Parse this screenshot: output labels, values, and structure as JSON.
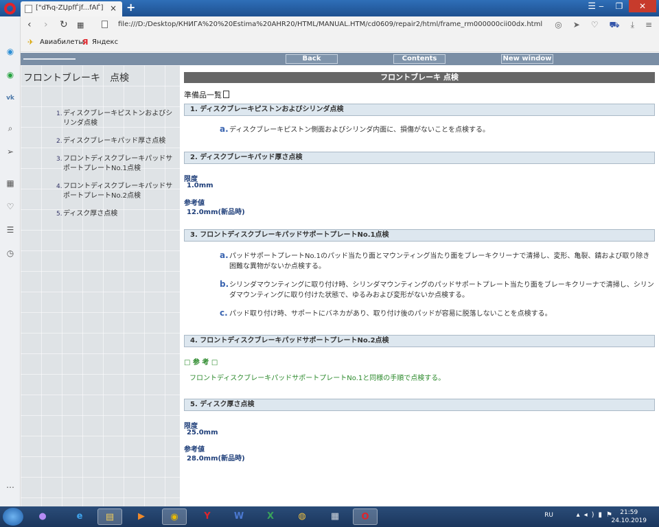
{
  "browser": {
    "tab_title": "[\"dЋq-ZЏpfЃjf...fAЃ]",
    "tab_close": "×",
    "newtab": "+",
    "url": "file:///D:/Desktop/КНИГА%20%20Estima%20AHR20/HTML/MANUAL.HTM/cd0609/repair2/html/frame_rm000000cii00dx.html",
    "bookmarks": [
      "Авиабилеты",
      "Яндекс"
    ]
  },
  "toolbar": {
    "back": "Back",
    "contents": "Contents",
    "new_window": "New window"
  },
  "leftnav": {
    "title": "フロントブレーキ　点検",
    "items": [
      {
        "num": "1.",
        "label": "ディスクブレーキピストンおよびシリンダ点検"
      },
      {
        "num": "2.",
        "label": "ディスクブレーキパッド厚さ点検"
      },
      {
        "num": "3.",
        "label": "フロントディスクブレーキパッドサポートプレートNo.1点検"
      },
      {
        "num": "4.",
        "label": "フロントディスクブレーキパッドサポートプレートNo.2点検"
      },
      {
        "num": "5.",
        "label": "ディスク厚さ点検"
      }
    ]
  },
  "main": {
    "title": "フロントブレーキ 点検",
    "prep": "準備品一覧",
    "sections": [
      "1. ディスクブレーキピストンおよびシリンダ点検",
      "2. ディスクブレーキパッド厚さ点検",
      "3. フロントディスクブレーキパッドサポートプレートNo.1点検",
      "4. フロントディスクブレーキパッドサポートプレートNo.2点検",
      "5. ディスク厚さ点検"
    ],
    "s1_a": {
      "ltr": "a.",
      "text": "ディスクブレーキピストン側面およびシリンダ内面に、損傷がないことを点検する。"
    },
    "s2": {
      "limit_label": "限度",
      "limit_value": "1.0mm",
      "ref_label": "参考値",
      "ref_value": "12.0mm(新品時)"
    },
    "s3_items": [
      {
        "ltr": "a.",
        "text": "パッドサポートプレートNo.1のパッド当たり面とマウンティング当たり面をブレーキクリーナで清掃し、変形、亀裂、錆および取り除き困難な異物がないか点検する。"
      },
      {
        "ltr": "b.",
        "text": "シリンダマウンティングに取り付け時、シリンダマウンティングのパッドサポートプレート当たり面をブレーキクリーナで清掃し、シリンダマウンティングに取り付けた状態で、ゆるみおよび変形がないか点検する。"
      },
      {
        "ltr": "c.",
        "text": "パッド取り付け時、サポートにバネカがあり、取り付け後のパッドが容易に脱落しないことを点検する。"
      }
    ],
    "s4": {
      "ref_head": "□ 参 考 □",
      "ref_text": "フロントディスクブレーキパッドサポートプレートNo.1と同様の手順で点検する。"
    },
    "s5": {
      "limit_label": "限度",
      "limit_value": "25.0mm",
      "ref_label": "参考値",
      "ref_value": "28.0mm(新品時)"
    }
  },
  "taskbar": {
    "lang": "RU",
    "time": "21:59",
    "date": "24.10.2019"
  }
}
